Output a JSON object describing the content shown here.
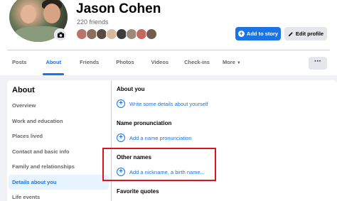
{
  "profile": {
    "name": "Jason Cohen",
    "friends_count": "220 friends"
  },
  "actions": {
    "add_story_label": "Add to story",
    "edit_profile_label": "Edit profile",
    "more_options_label": "···"
  },
  "tabs": [
    {
      "label": "Posts"
    },
    {
      "label": "About",
      "active": true
    },
    {
      "label": "Friends"
    },
    {
      "label": "Photos"
    },
    {
      "label": "Videos"
    },
    {
      "label": "Check-ins"
    },
    {
      "label": "More"
    }
  ],
  "about": {
    "title": "About",
    "menu": [
      {
        "label": "Overview"
      },
      {
        "label": "Work and education"
      },
      {
        "label": "Places lived"
      },
      {
        "label": "Contact and basic info"
      },
      {
        "label": "Family and relationships"
      },
      {
        "label": "Details about you",
        "active": true
      },
      {
        "label": "Life events"
      }
    ]
  },
  "details": {
    "about_you": {
      "title": "About you",
      "action": "Write some details about yourself"
    },
    "name_pronunciation": {
      "title": "Name pronunciation",
      "action": "Add a name pronunciation"
    },
    "other_names": {
      "title": "Other names",
      "action": "Add a nickname, a birth name..."
    },
    "favorite_quotes": {
      "title": "Favorite quotes"
    }
  },
  "colors": {
    "accent": "#1b74e4",
    "highlight_box": "#d9161f",
    "page_bg": "#f0f2f5"
  }
}
